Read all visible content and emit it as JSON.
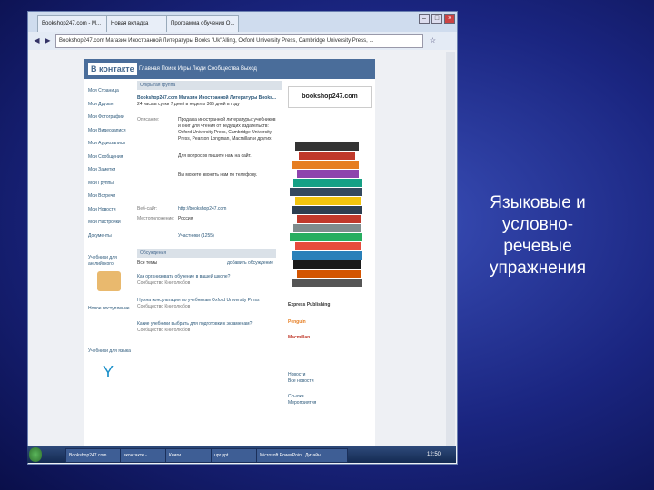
{
  "slide": {
    "title_lines": [
      "Языковые и",
      "условно-",
      "речевые",
      "упражнения"
    ]
  },
  "browser": {
    "tabs": [
      "Bookshop247.com - M...",
      "Новая вкладка",
      "Программа обучения О..."
    ],
    "address": "Bookshop247.com Магазин Иностранной Литературы Books \"Uk\"Alling, Oxford University Press, Cambridge University Press, ..."
  },
  "vk": {
    "logo": "В контакте",
    "nav": "Главная   Поиск   Игры   Люди   Сообщества   Выход",
    "menu": [
      "Моя Страница",
      "Мои Друзья",
      "Мои Фотографии",
      "Мои Видеозаписи",
      "Мои Аудиозаписи",
      "Мои Сообщения",
      "Мои Заметки",
      "Мои Группы",
      "Мои Встречи",
      "Мои Новости",
      "Мои Настройки"
    ],
    "documents": "Документы",
    "group_header": "Открытая группа",
    "group_title": "Bookshop247.com Магазин Иностранной Литературы Books...",
    "group_sub": "24 часа в сутки 7 дней в неделю 365 дней в году",
    "desc_label": "Описание:",
    "desc_text": "Продажа иностранной литературы: учебников и книг для чтения от ведущих издательств: Oxford University Press, Cambridge University Press, Pearson Longman, Macmillan и других.",
    "order_text": "Для вопросов пишите нам на сайт.",
    "call_text": "Вы можете звонить нам по телефону.",
    "site_label": "Веб-сайт:",
    "site": "http://bookshop247.com",
    "location_label": "Местоположение:",
    "location": "Россия",
    "members": "Участники (1255)",
    "topics_header": "Обсуждения",
    "topics_meta": "Все темы",
    "topics_link": "добавить обсуждение",
    "topics": [
      "Как организовать обучение в вашей школе?",
      "Нужна консультация по учебникам Oxford University Press",
      "Какие учебники выбрать для подготовки к экзаменам?"
    ],
    "authors": "Сообщество Книголюбов",
    "left_ads": [
      "Учебники для английского",
      "Новое поступление",
      "Учебники для языка"
    ],
    "right_side": [
      "Новости",
      "Все новости",
      "Ссылки",
      "Мероприятия"
    ],
    "shop_logo": "bookshop247.com",
    "publishers": [
      "Express Publishing",
      "Penguin",
      "Macmillan"
    ]
  },
  "taskbar": {
    "items": [
      "Пуск",
      "Bookshop247.com...",
      "вконтакте - ...",
      "Книги",
      "Microsoft PowerPoint",
      "upr.ppt",
      "Дизайн"
    ],
    "clock": "12:50"
  },
  "colors": {
    "vk_blue": "#4a6d9a",
    "slide_bg": "#1a2580"
  }
}
